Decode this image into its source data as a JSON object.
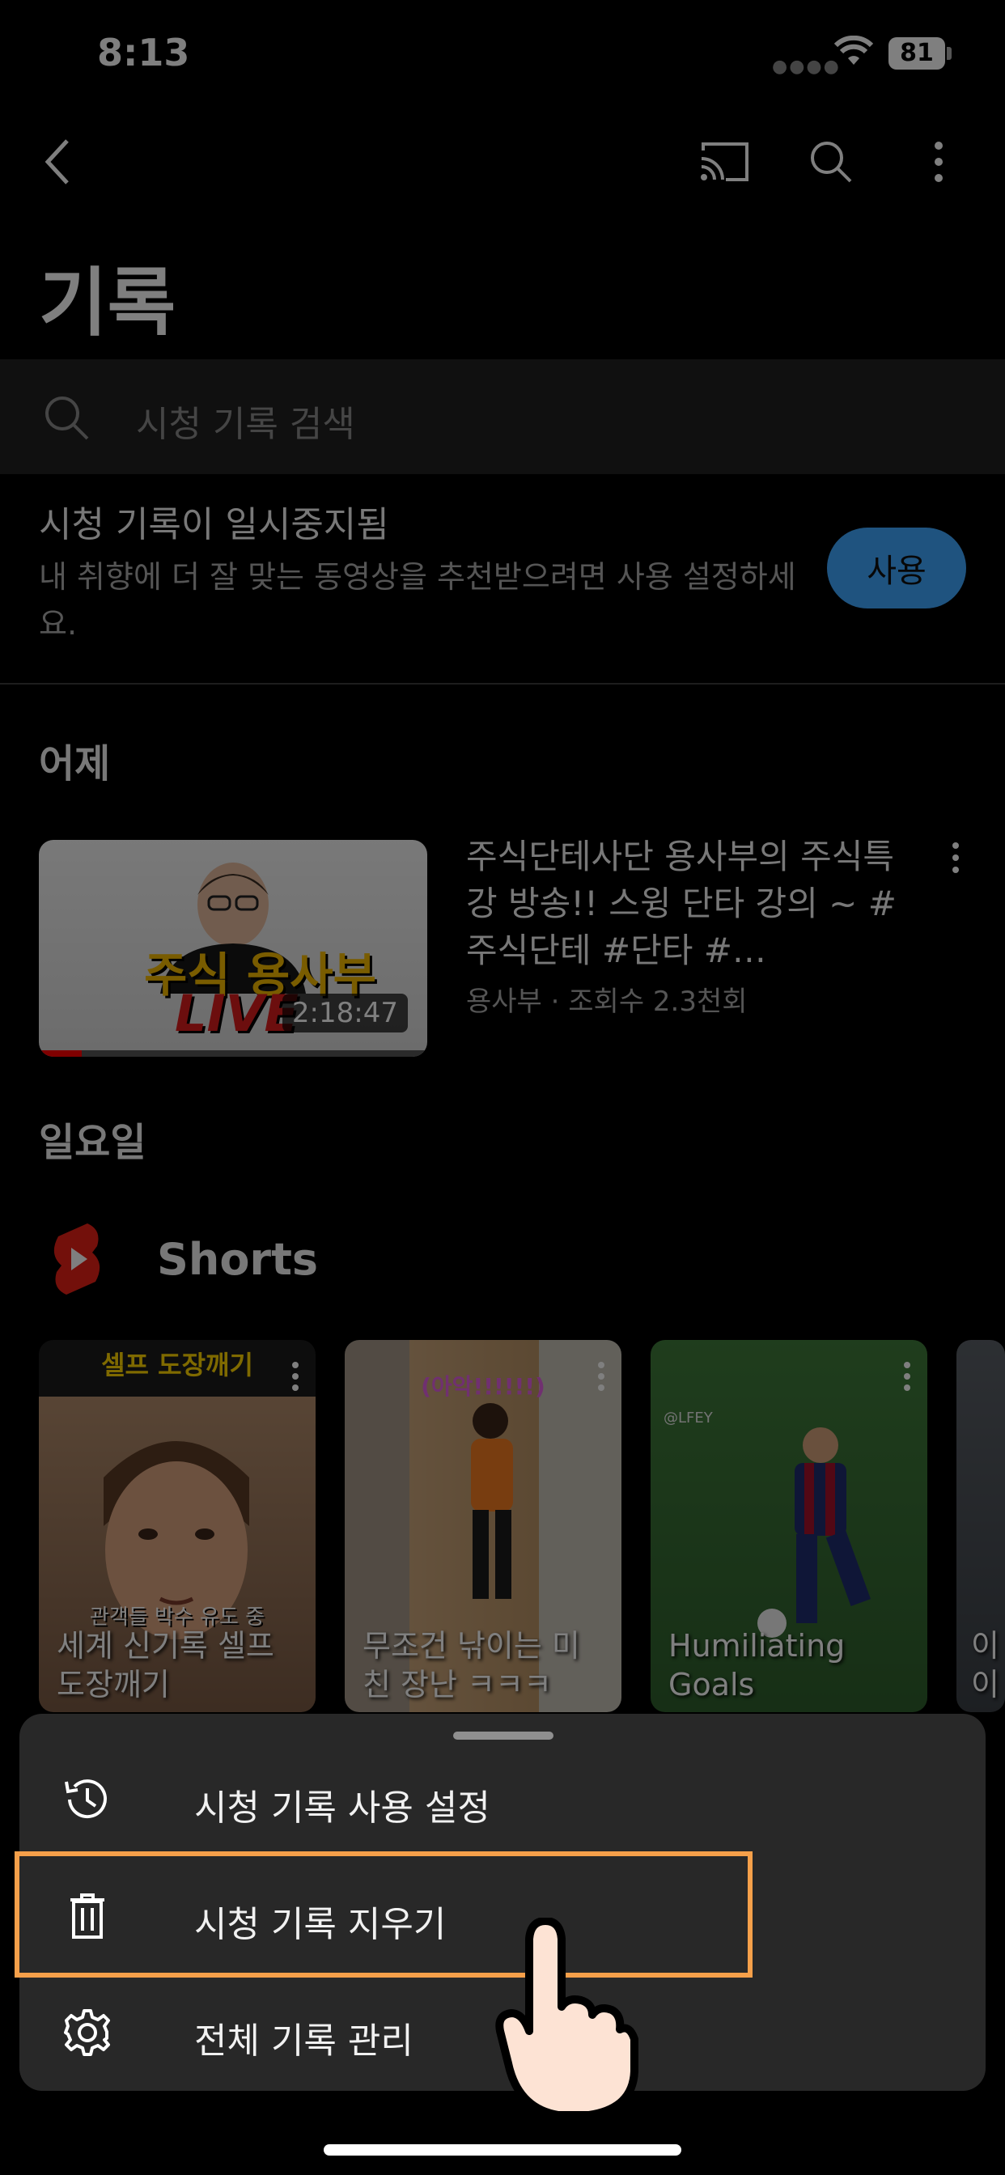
{
  "status": {
    "time": "8:13",
    "battery": "81"
  },
  "header": {
    "title": "기록"
  },
  "search": {
    "placeholder": "시청 기록 검색"
  },
  "paused": {
    "title": "시청 기록이 일시중지됨",
    "description": "내 취향에 더 잘 맞는 동영상을 추천받으려면 사용 설정하세요.",
    "button": "사용"
  },
  "sections": {
    "yesterday": "어제",
    "sunday": "일요일"
  },
  "video": {
    "thumb_text_1": "주식 용사부",
    "thumb_text_2": "LIVE",
    "duration": "2:18:47",
    "title": "주식단테사단 용사부의 주식특강 방송!! 스윙 단타 강의 ~ #주식단테 #단타 #…",
    "meta": "용사부 · 조회수 2.3천회",
    "progress_fraction": 0.11
  },
  "shorts": {
    "label": "Shorts",
    "items": [
      {
        "overlay": "셀프 도장깨기",
        "subtitle": "관객들 박수 유도 중",
        "caption": "세계 신기록 셀프 도장깨기"
      },
      {
        "overlay": "(아악!!!!!!)",
        "caption": "무조건 낚이는 미친 장난 ㅋㅋㅋ"
      },
      {
        "overlay": "@LFEY",
        "caption": "Humiliating Goals"
      },
      {
        "caption": "이 이"
      }
    ]
  },
  "sheet": {
    "items": [
      {
        "label": "시청 기록 사용 설정",
        "icon": "history-icon"
      },
      {
        "label": "시청 기록 지우기",
        "icon": "trash-icon"
      },
      {
        "label": "전체 기록 관리",
        "icon": "gear-icon"
      }
    ]
  },
  "colors": {
    "accent": "#3ea6ff",
    "highlight": "#f6a04a",
    "sheet_bg": "#282828"
  }
}
